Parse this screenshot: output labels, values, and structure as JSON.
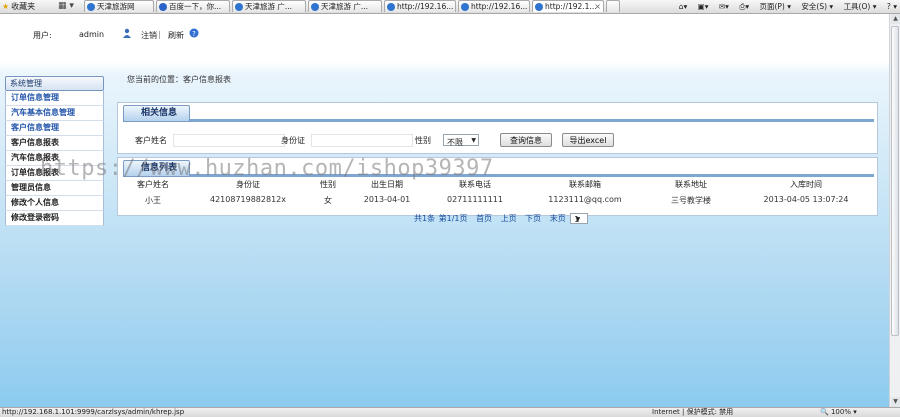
{
  "browser": {
    "favorites_label": "收藏夹",
    "tabs": [
      {
        "label": "天津旅游网"
      },
      {
        "label": "百度一下，你..."
      },
      {
        "label": "天津旅游 广..."
      },
      {
        "label": "天津旅游 广..."
      },
      {
        "label": "http://192.16..."
      },
      {
        "label": "http://192.16..."
      },
      {
        "label": "http://192.1..."
      }
    ],
    "tools": {
      "page": "页面(P) ▾",
      "safety": "安全(S) ▾",
      "tools": "工具(O) ▾",
      "help": "? ▾"
    },
    "status_url": "http://192.168.1.101:9999/carzlsys/admin/khrep.jsp",
    "status_zone": "Internet | 保护模式: 禁用",
    "status_zoom": "100%"
  },
  "top": {
    "user_label": "用户:",
    "user_name": "admin",
    "logout": "注销",
    "refresh": "刷新"
  },
  "sidebar": {
    "header": "系统管理",
    "items": [
      {
        "label": "订单信息管理"
      },
      {
        "label": "汽车基本信息管理"
      },
      {
        "label": "客户信息管理"
      },
      {
        "label": "客户信息报表"
      },
      {
        "label": "汽车信息报表"
      },
      {
        "label": "订单信息报表"
      },
      {
        "label": "管理员信息"
      },
      {
        "label": "修改个人信息"
      },
      {
        "label": "修改登录密码"
      }
    ]
  },
  "breadcrumb": "您当前的位置：客户信息报表",
  "search_panel": {
    "title": "相关信息",
    "name_label": "客户姓名",
    "name_value": "",
    "id_label": "身份证",
    "id_value": "",
    "gender_label": "性别",
    "gender_value": "不限",
    "query_button": "查询信息",
    "export_button": "导出excel"
  },
  "list_panel": {
    "title": "信息列表",
    "columns": [
      "客户姓名",
      "身份证",
      "性别",
      "出生日期",
      "联系电话",
      "联系邮箱",
      "联系地址",
      "入库时间"
    ],
    "rows": [
      [
        "小王",
        "42108719882812x",
        "女",
        "2013-04-01",
        "02711111111",
        "1123111@qq.com",
        "三号教学楼",
        "2013-04-05 13:07:24"
      ]
    ],
    "pager": {
      "total": "共1条",
      "pages": "第1/1页",
      "first": "首页",
      "prev": "上页",
      "next": "下页",
      "last": "末页",
      "page_select": "1"
    }
  },
  "watermark": "https://www.huzhan.com/ishop39397",
  "colors": {
    "accent": "#2255aa",
    "panel_border": "#b6c8dc",
    "title_text": "#1b3566"
  }
}
